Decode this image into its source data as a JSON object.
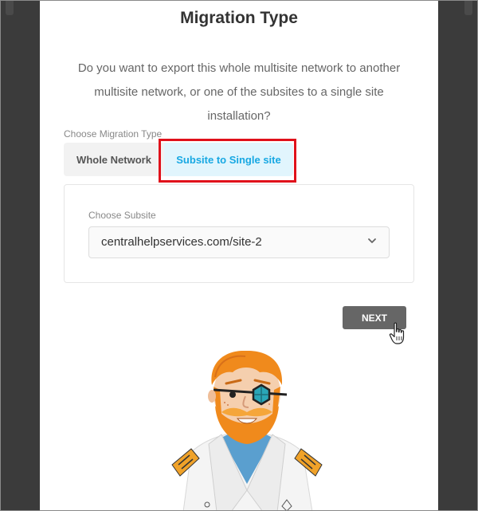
{
  "dialog": {
    "title": "Migration Type",
    "question": "Do you want to export this whole multisite network to another multisite network, or one of the subsites to a single site installation?"
  },
  "migration_type": {
    "label": "Choose Migration Type",
    "options": [
      {
        "label": "Whole Network",
        "selected": false
      },
      {
        "label": "Subsite to Single site",
        "selected": true
      }
    ]
  },
  "subsite": {
    "label": "Choose Subsite",
    "selected_value": "centralhelpservices.com/site-2"
  },
  "actions": {
    "next_label": "NEXT"
  },
  "colors": {
    "accent": "#17a8e3",
    "selected_bg": "#e1f5fd",
    "highlight": "#e0111b",
    "next_bg": "#666666"
  },
  "icons": {
    "dropdown": "chevron-down-icon",
    "cursor": "hand-pointer-icon",
    "mascot": "pirate-mascot-illustration"
  }
}
